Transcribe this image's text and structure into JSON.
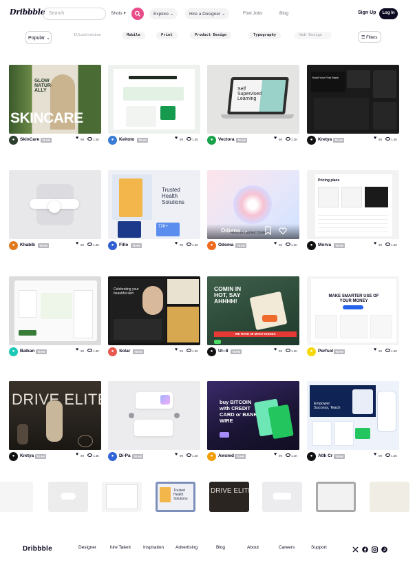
{
  "header": {
    "logo": "Dribbble",
    "search_placeholder": "Search",
    "shots_label": "Shots",
    "nav": [
      "Explore",
      "Hire a Designer",
      "Find Jobs",
      "Blog"
    ],
    "signup": "Sign Up",
    "login": "Log In"
  },
  "filters": {
    "sort": "Popular",
    "categories": [
      "Illustration",
      "Mobile",
      "Print",
      "Product Design",
      "Typography",
      "Web Design"
    ],
    "filters_label": "Filters"
  },
  "shots": [
    {
      "author": "SkinCare",
      "badge": "TEAM",
      "likes": "99",
      "views": "1.3K",
      "text": "GLOW NATUR-ALLY SKINCARE",
      "avatar_color": "#2c3e2c"
    },
    {
      "author": "Keitoto",
      "badge": "TEAM",
      "likes": "99",
      "views": "1.3K",
      "text": "",
      "avatar_color": "#3a7bd5"
    },
    {
      "author": "Vectora",
      "badge": "TEAM",
      "likes": "99",
      "views": "1.3K",
      "text": "Self Supervised Learning",
      "avatar_color": "#18a34a"
    },
    {
      "author": "Kretya",
      "badge": "TEAM",
      "likes": "99",
      "views": "1.3K",
      "text": "",
      "avatar_color": "#111111"
    },
    {
      "author": "Khabib",
      "badge": "TEAM",
      "likes": "99",
      "views": "1.3K",
      "text": "",
      "avatar_color": "#e07a1f"
    },
    {
      "author": "Fillo",
      "badge": "TEAM",
      "likes": "99",
      "views": "1.3K",
      "text": "Trusted Health Solutions",
      "avatar_color": "#2f5fd0"
    },
    {
      "author": "Odoma",
      "badge": "TEAM",
      "likes": "99",
      "views": "1.3K",
      "text": "Odoma ....",
      "avatar_color": "#f06a1d"
    },
    {
      "author": "Morva",
      "badge": "TEAM",
      "likes": "99",
      "views": "1.3K",
      "text": "Pricing plans",
      "avatar_color": "#111111"
    },
    {
      "author": "Balkan",
      "badge": "TEAM",
      "likes": "99",
      "views": "1.3K",
      "text": "",
      "avatar_color": "#1cc9b4"
    },
    {
      "author": "Solar",
      "badge": "TEAM",
      "likes": "99",
      "views": "1.3K",
      "text": "Celebrating your beautiful skin",
      "avatar_color": "#e85a4f"
    },
    {
      "author": "UI--8",
      "badge": "TEAM",
      "likes": "99",
      "views": "1.3K",
      "text": "COMIN IN HOT, SAY AHHHH! WE HAVE 30 MANY ISSUES",
      "avatar_color": "#111111"
    },
    {
      "author": "Perfsol",
      "badge": "TEAM",
      "likes": "99",
      "views": "1.3K",
      "text": "MAKE SMARTER USE OF YOUR MONEY",
      "avatar_color": "#f5d90a"
    },
    {
      "author": "Kretya",
      "badge": "TEAM",
      "likes": "99",
      "views": "1.3K",
      "text": "DRIVE ELITE",
      "avatar_color": "#111111"
    },
    {
      "author": "Di-Pa",
      "badge": "TEAM",
      "likes": "99",
      "views": "1.3K",
      "text": "",
      "avatar_color": "#3266d6"
    },
    {
      "author": "Awsmd",
      "badge": "TEAM",
      "likes": "99",
      "views": "1.3K",
      "text": "buy BITCOIN with CREDIT CARD or BANK WIRE",
      "avatar_color": "#f59e0b"
    },
    {
      "author": "Atlk Cr",
      "badge": "TEAM",
      "likes": "99",
      "views": "1.3K",
      "text": "Empower Success, Teach",
      "avatar_color": "#111111"
    }
  ],
  "footer": {
    "logo": "Dribbble",
    "links": [
      "Designer",
      "hire Talent",
      "Inspiration",
      "Advertising",
      "Blog",
      "About",
      "Careers",
      "Support"
    ],
    "social_icons": [
      "x-icon",
      "facebook-icon",
      "instagram-icon",
      "pinterest-icon"
    ]
  }
}
